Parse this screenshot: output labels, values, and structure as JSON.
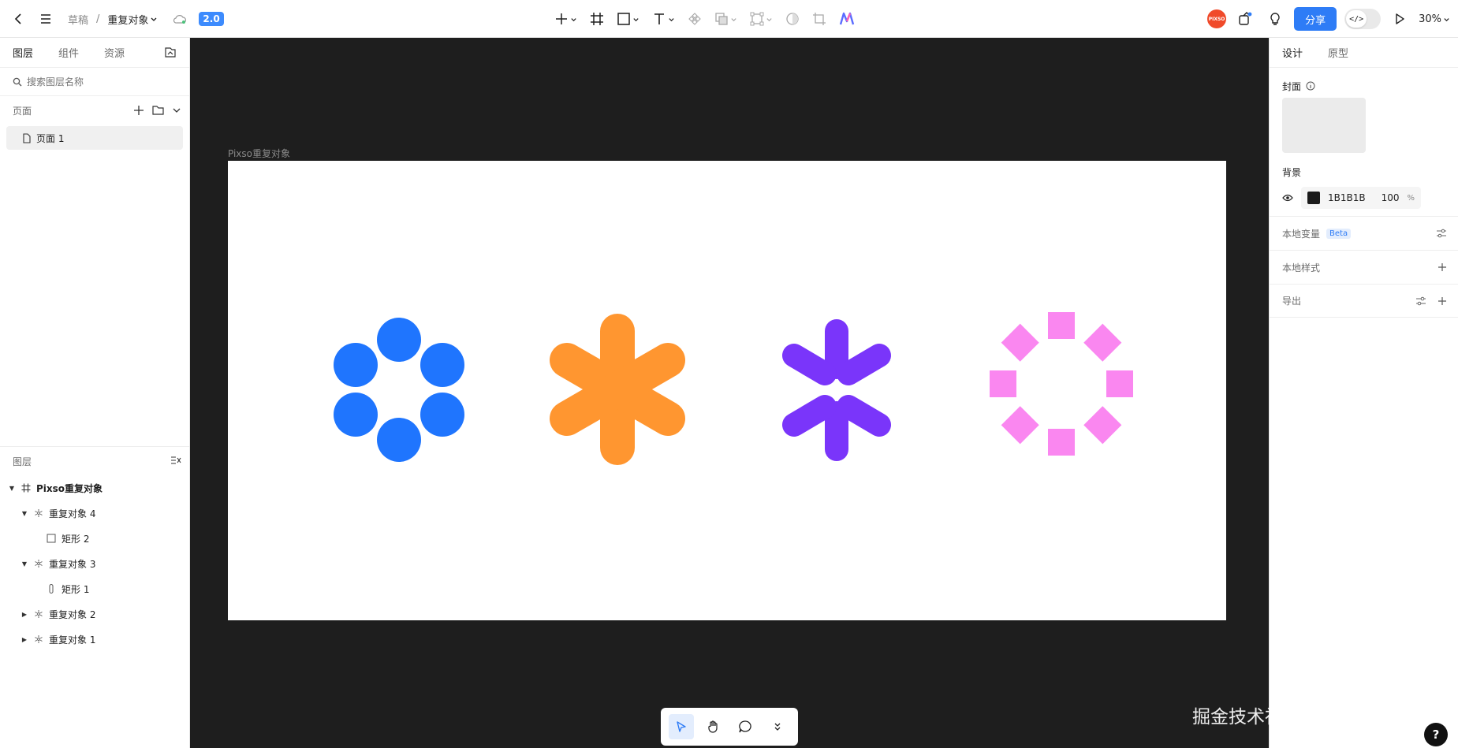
{
  "topbar": {
    "breadcrumb_parent": "草稿",
    "breadcrumb_sep": "/",
    "file_name": "重复对象",
    "version_badge": "2.0",
    "avatar_text": "PIXSO",
    "share_label": "分享",
    "dev_toggle_label": "</>",
    "zoom_level": "30%"
  },
  "left": {
    "tabs": [
      "图层",
      "组件",
      "资源"
    ],
    "search_placeholder": "搜索图层名称",
    "pages_title": "页面",
    "page_name": "页面 1",
    "layers_title": "图层",
    "layers": [
      {
        "name": "Pixso重复对象",
        "indent": 0,
        "caret": "open",
        "icon": "frame-icon"
      },
      {
        "name": "重复对象 4",
        "indent": 1,
        "caret": "open",
        "icon": "repeat-icon"
      },
      {
        "name": "矩形 2",
        "indent": 2,
        "caret": "none",
        "icon": "rect-icon"
      },
      {
        "name": "重复对象 3",
        "indent": 1,
        "caret": "open",
        "icon": "repeat-icon"
      },
      {
        "name": "矩形 1",
        "indent": 2,
        "caret": "none",
        "icon": "pill-icon"
      },
      {
        "name": "重复对象 2",
        "indent": 1,
        "caret": "closed",
        "icon": "repeat-icon"
      },
      {
        "name": "重复对象 1",
        "indent": 1,
        "caret": "closed",
        "icon": "repeat-icon"
      }
    ]
  },
  "canvas": {
    "frame_label": "Pixso重复对象",
    "background": "#1E1E1E",
    "shape_colors": {
      "blue": "#1F75FE",
      "orange": "#FF9630",
      "purple": "#7A35FA",
      "pink": "#FA87F0"
    }
  },
  "right": {
    "tabs": [
      "设计",
      "原型"
    ],
    "cover_title": "封面",
    "bg_title": "背景",
    "bg_hex": "1B1B1B",
    "bg_opacity": "100",
    "bg_opacity_unit": "%",
    "local_vars": "本地变量",
    "beta": "Beta",
    "local_styles": "本地样式",
    "export": "导出"
  },
  "watermark": "掘金技术社区 @ 职场工具箱",
  "help": "?"
}
